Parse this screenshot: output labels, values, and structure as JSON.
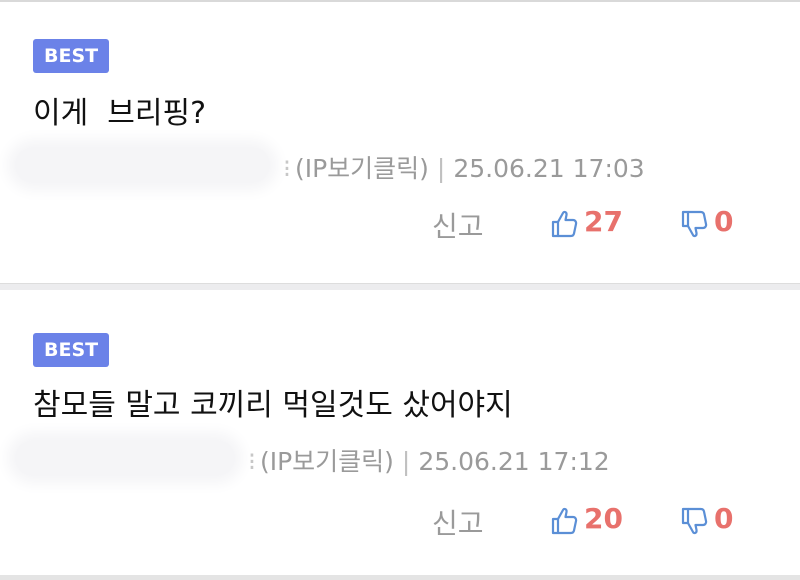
{
  "comments": [
    {
      "badge": "BEST",
      "text": "이게  브리핑?",
      "ip_link": "(IP보기클릭)",
      "separator": "|",
      "timestamp": "25.06.21 17:03",
      "report_label": "신고",
      "likes": "27",
      "dislikes": "0"
    },
    {
      "badge": "BEST",
      "text": "참모들 말고 코끼리 먹일것도 샀어야지",
      "ip_link": "(IP보기클릭)",
      "separator": "|",
      "timestamp": "25.06.21 17:12",
      "report_label": "신고",
      "likes": "20",
      "dislikes": "0"
    }
  ],
  "colors": {
    "badge": "#6b82e8",
    "count": "#e8716c",
    "icon": "#5b8fd6",
    "meta": "#9a9a9a"
  },
  "icons": {
    "like": "thumbs-up-icon",
    "dislike": "thumbs-down-icon"
  }
}
